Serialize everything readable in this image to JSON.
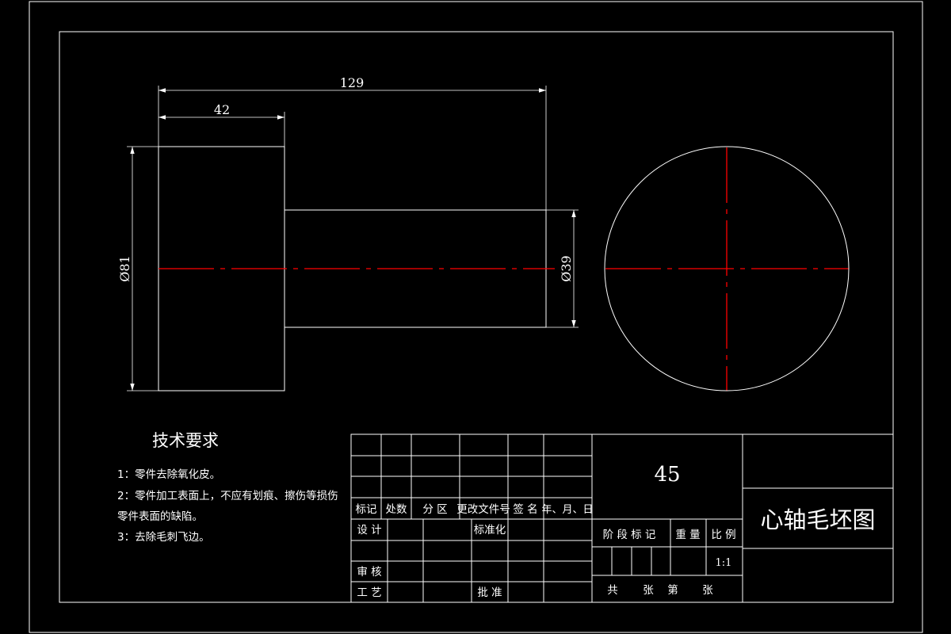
{
  "drawing": {
    "dimensions": {
      "overall_length": "129",
      "flange_length": "42",
      "large_diameter": "Ø81",
      "small_diameter": "Ø39"
    }
  },
  "tech_requirements": {
    "title": "技术要求",
    "line1": "1：零件去除氧化皮。",
    "line2": "2：零件加工表面上，不应有划痕、擦伤等损伤",
    "line3": "零件表面的缺陷。",
    "line4": "3：去除毛刺飞边。"
  },
  "title_block": {
    "material": "45",
    "drawing_title": "心轴毛坯图",
    "scale_value": "1:1",
    "labels": {
      "mark": "标记",
      "count": "处数",
      "zone": "分 区",
      "change_doc": "更改文件号",
      "signature": "签 名",
      "date": "年、月、日",
      "design": "设 计",
      "standardize": "标准化",
      "review": "审 核",
      "process": "工 艺",
      "approve": "批 准",
      "stage_mark": "阶 段 标 记",
      "weight": "重 量",
      "scale": "比 例",
      "sheets_total": "共",
      "sheet_unit1": "张",
      "sheet_no": "第",
      "sheet_unit2": "张"
    }
  },
  "colors": {
    "line": "#ffffff",
    "centerline": "#ff0000",
    "background": "#000000"
  }
}
